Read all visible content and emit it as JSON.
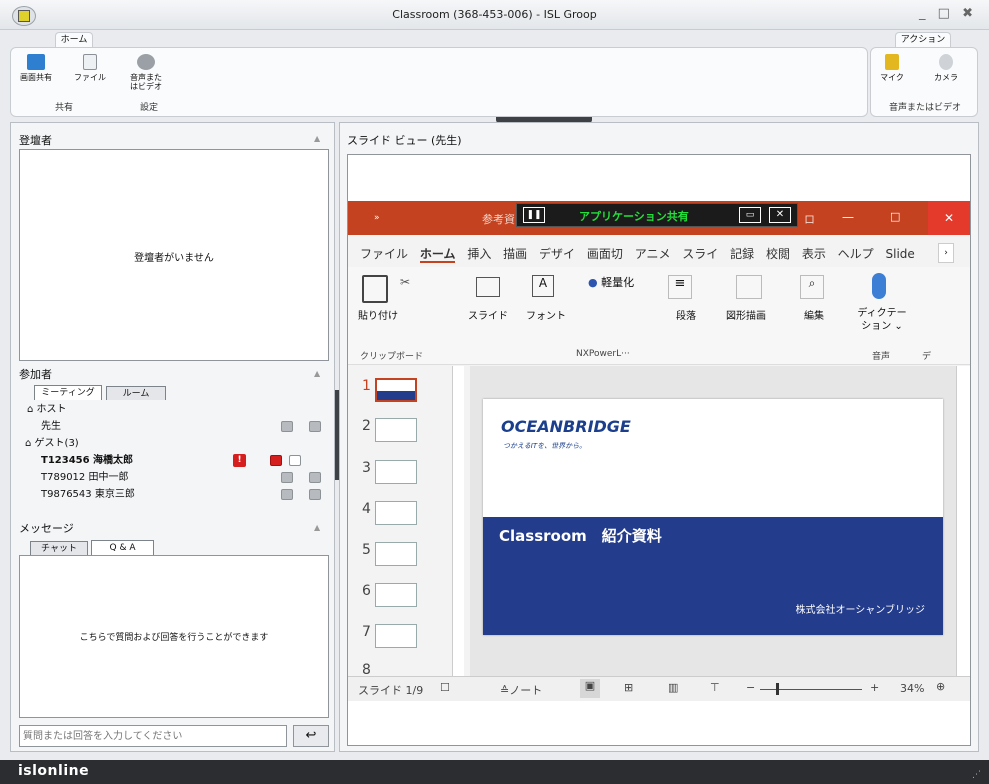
{
  "window": {
    "title": "Classroom (368-453-006) - ISL Groop",
    "controls": "_ □ ✖"
  },
  "ribbon": {
    "home_tab": "ホーム",
    "buttons": {
      "screen_share": "画面共有",
      "file": "ファイル",
      "audio_video": "音声また はビデオ"
    },
    "groups": {
      "share": "共有",
      "settings": "設定"
    },
    "action_tab": "アクション",
    "action_buttons": {
      "mic": "マイク",
      "camera": "カメラ"
    },
    "action_group": "音声またはビデオ"
  },
  "registrants": {
    "title": "登壇者",
    "empty": "登壇者がいません"
  },
  "participants": {
    "title": "参加者",
    "tabs": [
      "ミーティング",
      "ルーム"
    ],
    "host_label": "ホスト",
    "host": "先生",
    "guest_label": "ゲスト(3)",
    "guests": [
      "T123456 海橋太郎",
      "T789012 田中一郎",
      "T9876543 東京三郎"
    ],
    "alert_icon": "!"
  },
  "messages": {
    "title": "メッセージ",
    "tabs": [
      "チャット",
      "Q & A"
    ],
    "empty": "こちらで質問および回答を行うことができます",
    "input_placeholder": "質問または回答を入力してください",
    "send_icon": "↩"
  },
  "slide_view": {
    "title": "スライド ビュー (先生)"
  },
  "app_share_bar": {
    "label": "アプリケーション共有"
  },
  "ppt": {
    "title": "参考資",
    "title_fragment_right": "ロ",
    "menu": [
      "ファイル",
      "ホーム",
      "挿入",
      "描画",
      "デザイ",
      "画面切",
      "アニメ",
      "スライ",
      "記録",
      "校閲",
      "表示",
      "ヘルプ",
      "Slide"
    ],
    "ribbon": {
      "paste": "貼り付け",
      "slide": "スライド",
      "font": "フォント",
      "nx": "軽量化",
      "paragraph": "段落",
      "drawing": "図形描画",
      "edit": "編集",
      "dictate": "ディクテー ション ⌄",
      "groups": {
        "clipboard": "クリップボード",
        "nx": "NXPowerL···",
        "voice": "音声",
        "extra": "デ"
      }
    },
    "thumb_numbers": [
      "1",
      "2",
      "3",
      "4",
      "5",
      "6",
      "7",
      "8"
    ],
    "slide": {
      "logo": "OCEANBRIDGE",
      "tagline": "つかえるITを、世界から。",
      "heading": "Classroom　紹介資料",
      "company": "株式会社オーシャンブリッジ"
    },
    "status": {
      "slide_no": "スライド 1/9",
      "notes": "ノート",
      "zoom": "34%",
      "zoom_level": 0.34
    }
  },
  "footer": {
    "brand": "islonline"
  },
  "colors": {
    "ppt_red": "#c4421f",
    "slide_blue": "#233c8c",
    "share_green": "#22e03a",
    "brand_dark": "#2b2d30"
  }
}
